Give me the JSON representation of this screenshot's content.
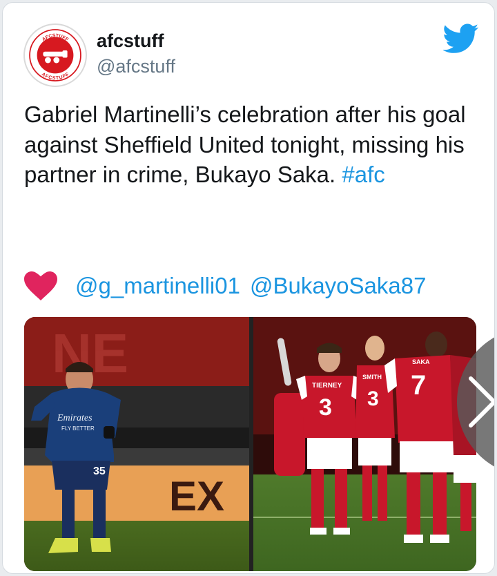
{
  "tweet": {
    "display_name": "afcstuff",
    "handle": "@afcstuff",
    "avatar_text_top": "AFCSTUFF",
    "avatar_text_bottom": "AFCSTUFF",
    "text": "Gabriel Martinelli’s celebration after his goal against Sheffield United tonight, missing his partner in crime, Bukayo Saka.",
    "hashtag": "#afc",
    "mentions": [
      "@g_martinelli01",
      "@BukayoSaka87"
    ],
    "heart_icon": "heart-icon",
    "brand_color": "#1da1f2",
    "link_color": "#1b95e0",
    "heart_color": "#e0245e"
  },
  "media": {
    "left_photo": {
      "shirt_sponsor": "Emirates",
      "shirt_tagline": "FLY BETTER",
      "shirt_number": "35",
      "board_text": "EX",
      "stand_text": "NE"
    },
    "right_photo": {
      "player_1_name": "TIERNEY",
      "player_1_number": "3",
      "player_2_name": "SMITH",
      "player_2_number": "3",
      "player_3_name": "SAKA",
      "player_3_number": "7"
    },
    "next_icon": "chevron-right-icon"
  }
}
